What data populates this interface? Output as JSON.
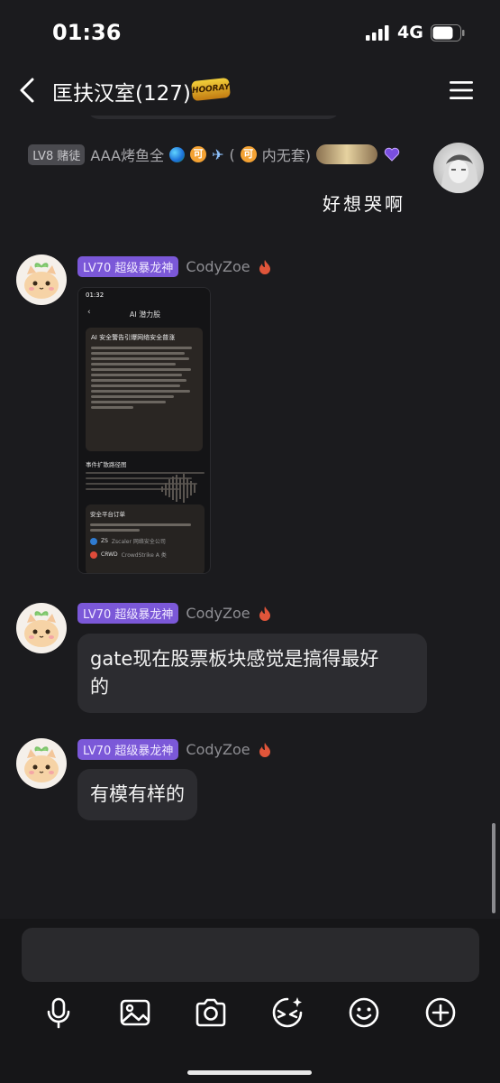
{
  "status_bar": {
    "time": "01:36",
    "network": "4G"
  },
  "header": {
    "title": "匡扶汉室(127)",
    "badge": "HOORAY"
  },
  "messages": [
    {
      "side": "right",
      "level_tag": "LV8 赌徒",
      "sender": "AAA烤鱼全",
      "sender_suffix_pre": "(",
      "sender_suffix": "内无套)",
      "text": "好想哭啊"
    },
    {
      "side": "left",
      "level_tag": "LV70 超级暴龙神",
      "sender": "CodyZoe",
      "type": "image",
      "screenshot": {
        "time": "01:32",
        "title": "AI 潜力股",
        "card_heading": "AI 安全警告引爆网络安全普涨",
        "section_title": "事件扩散路径图",
        "card2_heading": "安全平台订单",
        "rows": [
          {
            "ticker": "ZS",
            "name": "Zscaler 网络安全公司"
          },
          {
            "ticker": "CRWD",
            "name": "CrowdStrike A 类"
          }
        ]
      }
    },
    {
      "side": "left",
      "level_tag": "LV70 超级暴龙神",
      "sender": "CodyZoe",
      "text_line1": "gate现在股票板块感觉是搞得最好",
      "text_line2": "的"
    },
    {
      "side": "left",
      "level_tag": "LV70 超级暴龙神",
      "sender": "CodyZoe",
      "text": "有模有样的"
    }
  ],
  "toolbar": {
    "icons": [
      "microphone-icon",
      "image-icon",
      "camera-icon",
      "sticker-search-icon",
      "emoji-icon",
      "plus-icon"
    ]
  }
}
